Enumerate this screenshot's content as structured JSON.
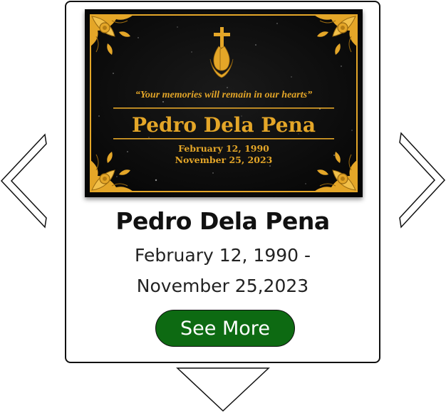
{
  "navigation": {
    "prev_icon": "chevron-left-icon",
    "next_icon": "chevron-right-icon",
    "down_icon": "triangle-down-icon"
  },
  "plaque": {
    "quote": "“Your memories will remain in our hearts”",
    "name": "Pedro Dela Pena",
    "birth_date": "February 12, 1990",
    "death_date": "November 25, 2023",
    "icons": [
      "cross-icon",
      "praying-hands-icon",
      "floral-corner-icon"
    ],
    "colors": {
      "stone": "#0b0b0b",
      "gold": "#e4a628"
    }
  },
  "card": {
    "name": "Pedro Dela Pena",
    "date_line1": "February 12, 1990 -",
    "date_line2": "November 25,2023",
    "button_label": "See More",
    "button_color": "#0d6a12"
  }
}
